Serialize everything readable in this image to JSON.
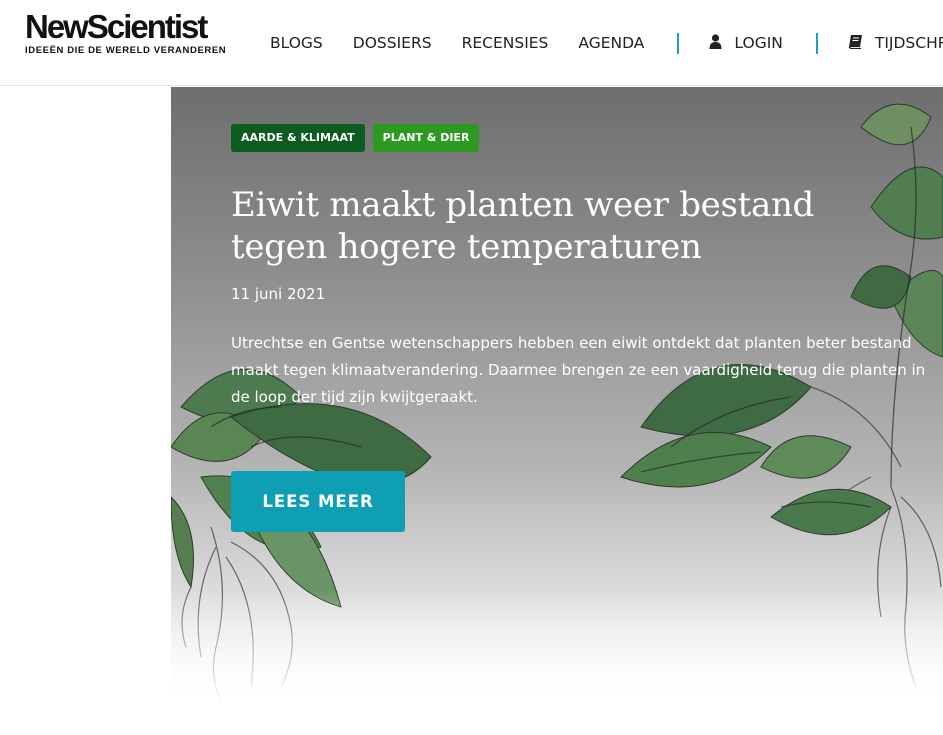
{
  "logo": {
    "name": "NewScientist",
    "tagline": "IDEEËN DIE DE WERELD VERANDEREN"
  },
  "nav": {
    "items": [
      "BLOGS",
      "DOSSIERS",
      "RECENSIES",
      "AGENDA"
    ],
    "login_label": "LOGIN",
    "login_icon": "user-icon",
    "magazine_label": "TIJDSCHRIF",
    "magazine_icon": "book-icon",
    "separator_color": "#1aa3ba"
  },
  "hero": {
    "tags": [
      {
        "label": "AARDE & KLIMAAT",
        "color": "#0c5c1f"
      },
      {
        "label": "PLANT & DIER",
        "color": "#2c9a20"
      }
    ],
    "title": "Eiwit maakt planten weer bestand tegen hogere temperaturen",
    "date": "11 juni 2021",
    "text": "Utrechtse en Gentse wetenschappers hebben een eiwit ontdekt dat planten beter bestand maakt tegen klimaatverandering. Daarmee brengen ze een vaardigheid terug die planten in de loop der tijd zijn kwijtgeraakt.",
    "button_label": "LEES MEER",
    "button_color": "#0f9fb4"
  }
}
